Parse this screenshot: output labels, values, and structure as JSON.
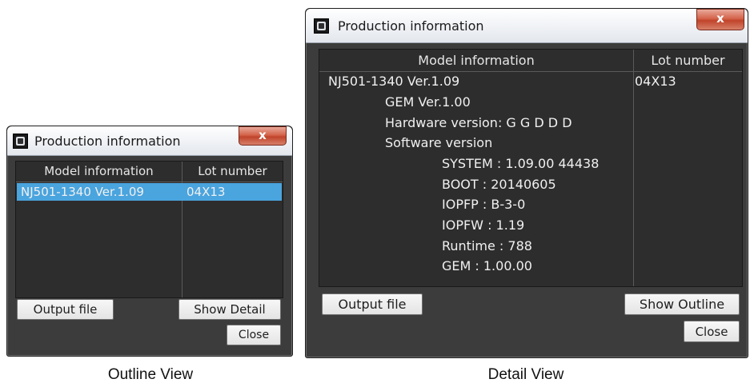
{
  "outline": {
    "window_title": "Production information",
    "close_glyph": "x",
    "columns": [
      "Model information",
      "Lot number"
    ],
    "row": {
      "model": "NJ501-1340 Ver.1.09",
      "lot": "04X13"
    },
    "buttons": {
      "output": "Output file",
      "toggle": "Show Detail",
      "close": "Close"
    },
    "caption": "Outline View"
  },
  "detail": {
    "window_title": "Production information",
    "close_glyph": "x",
    "columns": [
      "Model information",
      "Lot number"
    ],
    "model": "NJ501-1340 Ver.1.09",
    "lot": "04X13",
    "gem_version": "GEM Ver.1.00",
    "hardware_version": "Hardware version: G G D D D",
    "software_version_label": "Software version",
    "software_items": [
      "SYSTEM : 1.09.00 44438",
      "BOOT : 20140605",
      "IOPFP : B-3-0",
      "IOPFW : 1.19",
      "Runtime : 788",
      "GEM : 1.00.00"
    ],
    "buttons": {
      "output": "Output file",
      "toggle": "Show Outline",
      "close": "Close"
    },
    "caption": "Detail View"
  },
  "colors": {
    "dialog_bg": "#3c3c3c",
    "panel_bg": "#2d2d2d",
    "selection": "#4aa4de",
    "close_button": "#c0442a"
  },
  "icons": [
    "app-icon",
    "close-icon"
  ]
}
